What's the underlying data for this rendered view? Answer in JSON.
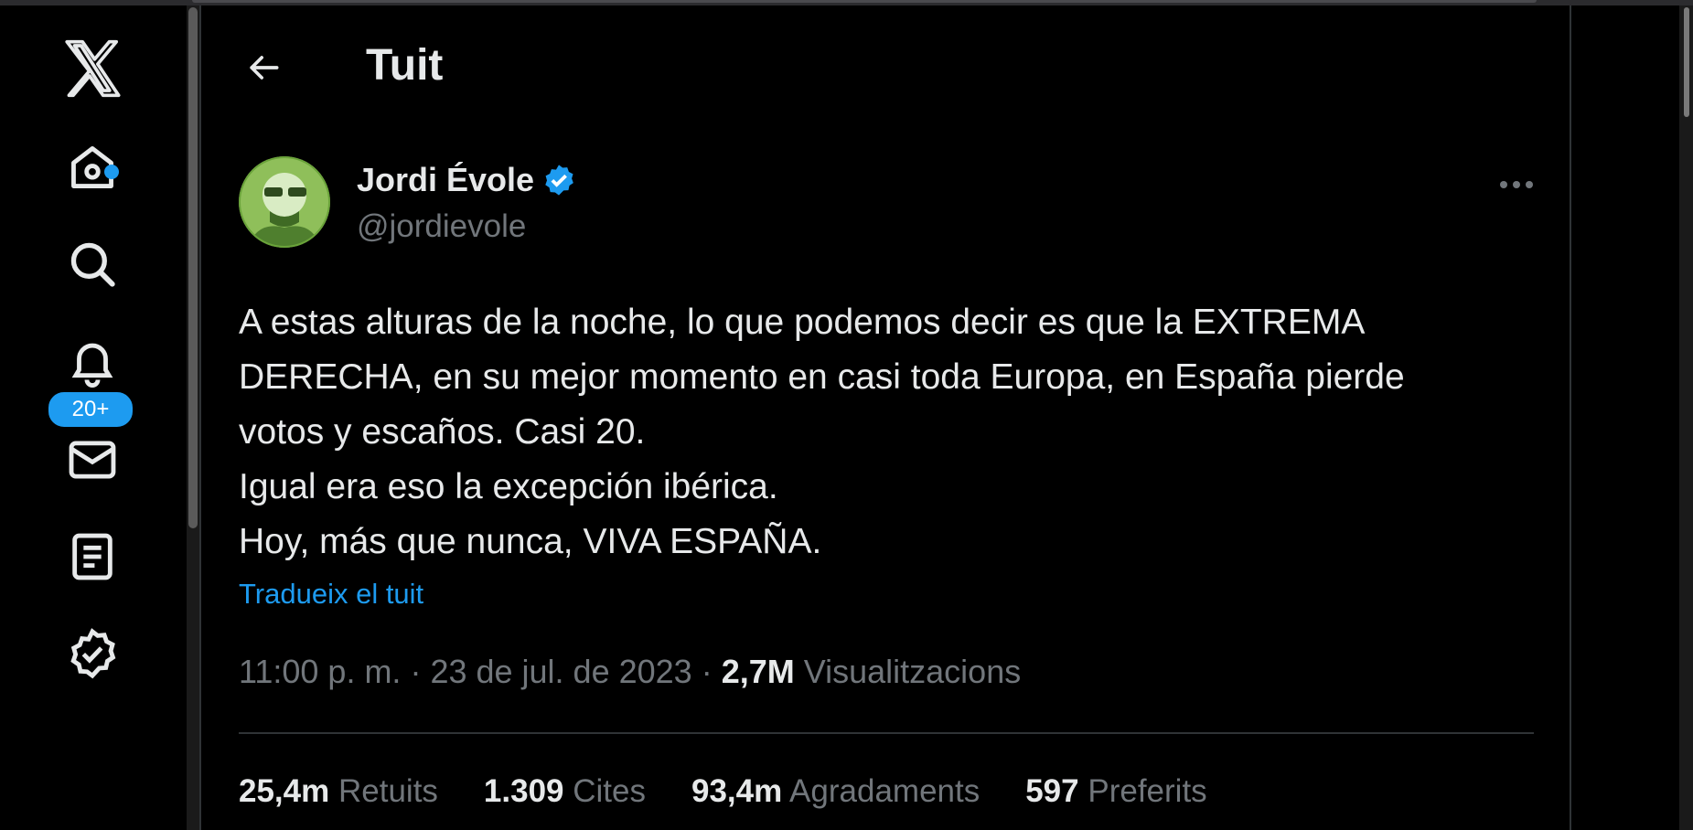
{
  "window": {
    "title": "Tuit"
  },
  "nav": {
    "items": [
      {
        "icon": "x-logo-icon"
      },
      {
        "icon": "home-icon"
      },
      {
        "icon": "search-icon"
      },
      {
        "icon": "bell-icon",
        "badge": "20+"
      },
      {
        "icon": "mail-icon"
      },
      {
        "icon": "list-icon"
      },
      {
        "icon": "verified-icon"
      }
    ],
    "notifications_badge": "20+"
  },
  "header": {
    "title": "Tuit",
    "back_icon": "arrow-left-icon"
  },
  "tweet": {
    "author_name": "Jordi Évole",
    "author_handle": "@jordievole",
    "verified": true,
    "lines": [
      "A estas alturas de la noche, lo que podemos decir es que la EXTREMA",
      "DERECHA, en su mejor momento en casi toda Europa, en España pierde",
      "votos y escaños. Casi 20.",
      "Igual era eso la excepción ibérica.",
      "Hoy, más que nunca, VIVA ESPAÑA."
    ],
    "translate_label": "Tradueix el tuit",
    "time": "11:00 p. m.",
    "date": "23 de jul. de 2023",
    "views_count": "2,7M",
    "views_label": "Visualitzacions",
    "stats": {
      "retweets_count": "25,4m",
      "retweets_label": "Retuits",
      "quotes_count": "1.309",
      "quotes_label": "Cites",
      "likes_count": "93,4m",
      "likes_label": "Agradaments",
      "bookmarks_count": "597",
      "bookmarks_label": "Preferits"
    }
  },
  "colors": {
    "accent": "#1d9bf0",
    "background": "#000000",
    "text": "#e7e9ea",
    "muted": "#71767b",
    "border": "#2f3336"
  }
}
